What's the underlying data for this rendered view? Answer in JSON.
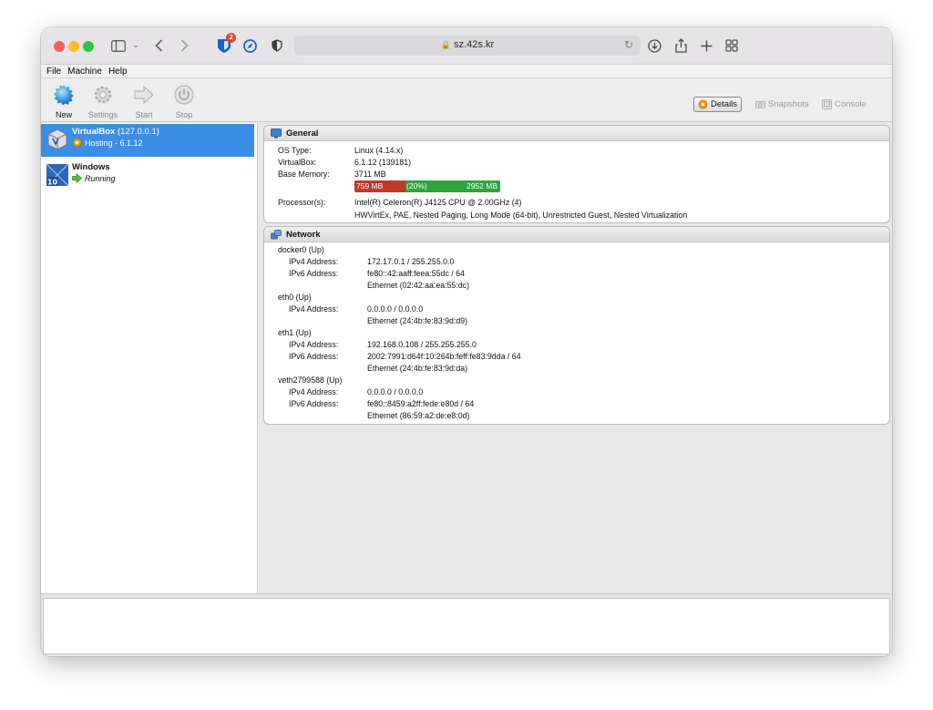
{
  "browser": {
    "url": "sz.42s.kr",
    "badge_count": "2"
  },
  "menubar": {
    "items": [
      "File",
      "Machine",
      "Help"
    ]
  },
  "toolbar": {
    "new_label": "New",
    "settings_label": "Settings",
    "start_label": "Start",
    "stop_label": "Stop",
    "details_label": "Details",
    "snapshots_label": "Snapshots",
    "console_label": "Console"
  },
  "vms": [
    {
      "name": "VirtualBox",
      "host": "(127.0.0.1)",
      "state": "Hosting - 6.1.12",
      "selected": true
    },
    {
      "name": "Windows",
      "host": "",
      "state": "Running",
      "selected": false,
      "os_badge": "10"
    }
  ],
  "general": {
    "title": "General",
    "os_type_label": "OS Type:",
    "os_type_value": "Linux (4.14.x)",
    "vbox_label": "VirtualBox:",
    "vbox_value": "6.1.12 (139181)",
    "mem_label": "Base Memory:",
    "mem_value": "3711 MB",
    "mem_used": "759 MB",
    "mem_pct": "(20%)",
    "mem_free": "2952 MB",
    "mem_used_fraction": 0.2,
    "proc_label": "Processor(s):",
    "proc_value": "Intel(R) Celeron(R) J4125 CPU @ 2.00GHz (4)",
    "proc_features": "HWVirtEx, PAE, Nested Paging, Long Mode (64-bit), Unrestricted Guest, Nested Virtualization"
  },
  "network": {
    "title": "Network",
    "ipv4_label": "IPv4 Address:",
    "ipv6_label": "IPv6 Address:",
    "interfaces": [
      {
        "name": "docker0 (Up)",
        "ipv4": "172.17.0.1 / 255.255.0.0",
        "ipv6": "fe80::42:aaff:feea:55dc / 64",
        "ether": "Ethernet (02:42:aa:ea:55:dc)"
      },
      {
        "name": "eth0 (Up)",
        "ipv4": "0.0.0.0 / 0.0.0.0",
        "ether": "Ethernet (24:4b:fe:83:9d:d9)"
      },
      {
        "name": "eth1 (Up)",
        "ipv4": "192.168.0.108 / 255.255.255.0",
        "ipv6": "2002:7991:d64f:10:264b:feff:fe83:9dda / 64",
        "ether": "Ethernet (24:4b:fe:83:9d:da)"
      },
      {
        "name": "veth2799588 (Up)",
        "ipv4": "0.0.0.0 / 0.0.0.0",
        "ipv6": "fe80::8459:a2ff:fede:e80d / 64",
        "ether": "Ethernet (86:59:a2:de:e8:0d)"
      }
    ]
  }
}
